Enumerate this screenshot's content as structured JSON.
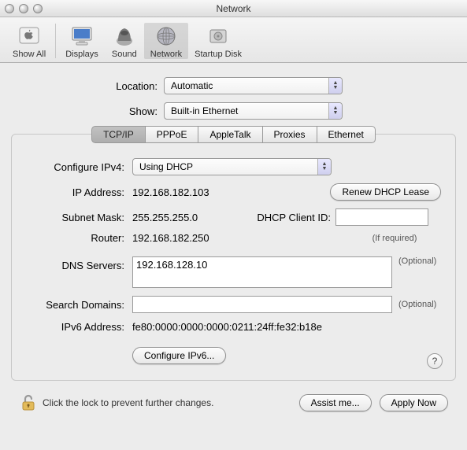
{
  "window": {
    "title": "Network"
  },
  "toolbar": {
    "show_all": "Show All",
    "displays": "Displays",
    "sound": "Sound",
    "network": "Network",
    "startup_disk": "Startup Disk"
  },
  "locationLabel": "Location:",
  "locationValue": "Automatic",
  "showLabel": "Show:",
  "showValue": "Built-in Ethernet",
  "tabs": {
    "tcpip": "TCP/IP",
    "pppoe": "PPPoE",
    "appletalk": "AppleTalk",
    "proxies": "Proxies",
    "ethernet": "Ethernet"
  },
  "configureLabel": "Configure IPv4:",
  "configureValue": "Using DHCP",
  "ipLabel": "IP Address:",
  "ipValue": "192.168.182.103",
  "renewBtn": "Renew DHCP Lease",
  "subnetLabel": "Subnet Mask:",
  "subnetValue": "255.255.255.0",
  "clientIdLabel": "DHCP Client ID:",
  "clientIdHint": "(If required)",
  "clientIdValue": "",
  "routerLabel": "Router:",
  "routerValue": "192.168.182.250",
  "dnsLabel": "DNS Servers:",
  "dnsValue": "192.168.128.10",
  "searchLabel": "Search Domains:",
  "searchValue": "",
  "optional": "(Optional)",
  "ipv6Label": "IPv6 Address:",
  "ipv6Value": "fe80:0000:0000:0000:0211:24ff:fe32:b18e",
  "configIpv6Btn": "Configure IPv6...",
  "helpBtn": "?",
  "lockText": "Click the lock to prevent further changes.",
  "assistBtn": "Assist me...",
  "applyBtn": "Apply Now"
}
